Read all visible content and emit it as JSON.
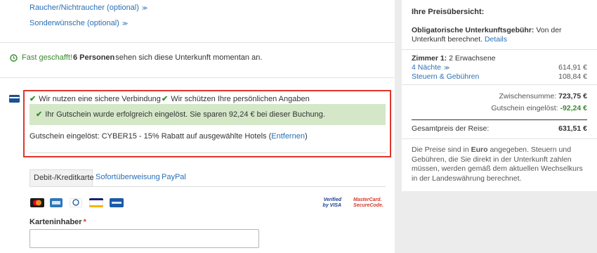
{
  "options": {
    "smoking": "Raucher/Nichtraucher (optional)",
    "requests": "Sonderwünsche (optional)"
  },
  "notice": {
    "prefix": "Fast geschafft! ",
    "persons": "6 Personen",
    "suffix": " sehen sich diese Unterkunft momentan an."
  },
  "security": {
    "secure_connection": "Wir nutzen eine sichere Verbindung",
    "protect_data": "Wir schützen Ihre persönlichen Angaben"
  },
  "coupon": {
    "success_message": "Ihr Gutschein wurde erfolgreich eingelöst. Sie sparen 92,24 € bei dieser Buchung.",
    "applied_prefix": "Gutschein eingelöst: CYBER15 - 15% Rabatt auf ausgewählte Hotels (",
    "remove_label": "Entfernen",
    "applied_suffix": ")"
  },
  "payment": {
    "tabs": [
      "Debit-/Kreditkarte",
      "Sofortüberweisung",
      "PayPal"
    ],
    "badges": [
      "Verified by VISA",
      "MasterCard. SecureCode."
    ],
    "cardholder_label": "Karteninhaber",
    "required_mark": "*",
    "cardholder_value": ""
  },
  "summary": {
    "title": "Ihre Preisübersicht:",
    "mandatory_bold": "Obligatorische Unterkunftsgebühr:",
    "mandatory_text": " Von der Unterkunft berechnet.",
    "details_label": "Details",
    "room_label": "Zimmer 1:",
    "room_guests": " 2 Erwachsene",
    "nights_label": "4 Nächte",
    "nights_price": "614,91 €",
    "taxes_label": "Steuern & Gebühren",
    "taxes_price": "108,84 €",
    "subtotal_label": "Zwischensumme:",
    "subtotal_value": "723,75 €",
    "coupon_label": "Gutschein eingelöst:",
    "coupon_value": "-92,24 €",
    "total_label": "Gesamtpreis der Reise:",
    "total_value": "631,51 €",
    "note_prefix": "Die Preise sind in ",
    "note_currency": "Euro",
    "note_suffix": " angegeben. Steuern und Gebühren, die Sie direkt in der Unterkunft zahlen müssen, werden gemäß dem aktuellen Wechselkurs in der Landeswährung berechnet."
  },
  "colors": {
    "accent_link": "#2a6fb5",
    "success_bg": "#d4e8c8",
    "highlight_border": "#e0362c",
    "coupon_value": "#3a8a2e"
  },
  "icons": [
    "chevron-down-icon",
    "clock-icon",
    "credit-card-icon",
    "check-icon"
  ]
}
